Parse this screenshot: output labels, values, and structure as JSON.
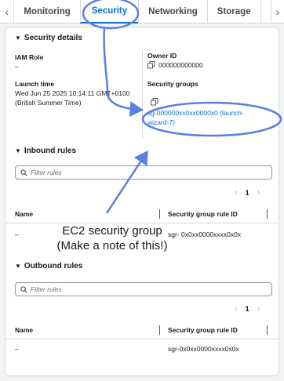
{
  "tabs": {
    "items": [
      "Monitoring",
      "Security",
      "Networking",
      "Storage"
    ],
    "active": "Security"
  },
  "security_details": {
    "heading": "Security details",
    "iam_role_label": "IAM Role",
    "iam_role_value": "–",
    "owner_id_label": "Owner ID",
    "owner_id_value": "000000000000",
    "launch_time_label": "Launch time",
    "launch_time_value_line1": "Wed Jun 25 2025 10:14:11 GMT+0100",
    "launch_time_value_line2": "(British Summer Time)",
    "security_groups_label": "Security groups",
    "security_group_link_line1": "sg-000000xx0xx0000x0 (launch-",
    "security_group_link_line2": "wizard-7)"
  },
  "inbound": {
    "heading": "Inbound rules",
    "filter_placeholder": "Filter rules",
    "page": "1",
    "col_name": "Name",
    "col_rule_id": "Security group rule ID",
    "row_name": "–",
    "row_rule_id": "sgr- 0x0xx0000xxxx0x0x"
  },
  "outbound": {
    "heading": "Outbound rules",
    "filter_placeholder": "Filter rules",
    "page": "1",
    "col_name": "Name",
    "col_rule_id": "Security group rule ID",
    "row_name": "–",
    "row_rule_id": "sgr-0x0xx0000xxxx0x0x"
  },
  "annotation": {
    "line1": "EC2 security group",
    "line2": "(Make a note of this!)",
    "color": "#5b7fe0"
  },
  "colors": {
    "link": "#0972d3",
    "border": "#d5dbdb"
  }
}
